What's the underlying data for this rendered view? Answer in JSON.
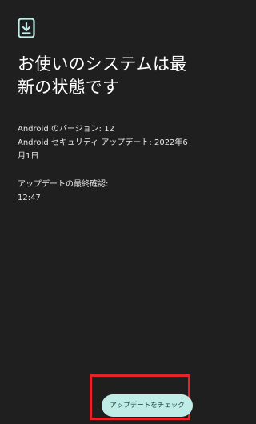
{
  "header": {
    "icon": "phone-download-icon",
    "title": "お使いのシステムは最新の状態です"
  },
  "info": {
    "android_version": "Android のバージョン: 12",
    "security_update": "Android セキュリティ アップデート: 2022年6月1日",
    "last_check_label": "アップデートの最終確認:",
    "last_check_time": "12:47"
  },
  "actions": {
    "check_button_label": "アップデートをチェック"
  },
  "colors": {
    "background": "#1f1f1f",
    "accent": "#bfece6",
    "highlight": "#e3242b"
  }
}
